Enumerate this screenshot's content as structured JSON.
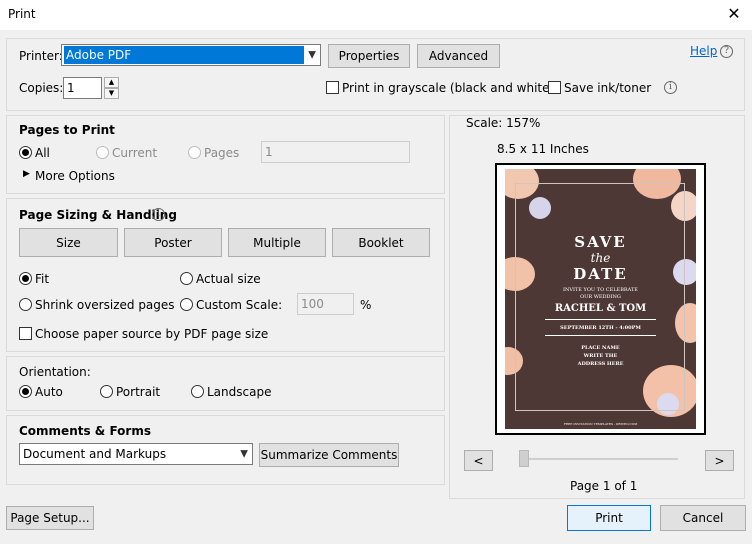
{
  "window": {
    "title": "Print",
    "close_glyph": "✕"
  },
  "printer": {
    "label": "Printer:",
    "selected": "Adobe PDF",
    "properties_label": "Properties",
    "advanced_label": "Advanced",
    "help_label": "Help"
  },
  "copies": {
    "label": "Copies:",
    "value": "1",
    "grayscale_label": "Print in grayscale (black and white)",
    "save_ink_label": "Save ink/toner"
  },
  "pages_to_print": {
    "header": "Pages to Print",
    "all_label": "All",
    "current_label": "Current",
    "pages_label": "Pages",
    "pages_value": "1",
    "more_options_label": "More Options"
  },
  "sizing": {
    "header": "Page Sizing & Handling",
    "size_label": "Size",
    "poster_label": "Poster",
    "multiple_label": "Multiple",
    "booklet_label": "Booklet",
    "fit_label": "Fit",
    "actual_size_label": "Actual size",
    "shrink_label": "Shrink oversized pages",
    "custom_scale_label": "Custom Scale:",
    "custom_scale_value": "100",
    "percent": "%",
    "paper_source_label": "Choose paper source by PDF page size"
  },
  "orientation": {
    "header": "Orientation:",
    "auto_label": "Auto",
    "portrait_label": "Portrait",
    "landscape_label": "Landscape"
  },
  "comments": {
    "header": "Comments & Forms",
    "selected": "Document and Markups",
    "summarize_label": "Summarize Comments"
  },
  "preview": {
    "scale": "Scale: 157%",
    "paper_size": "8.5 x 11 Inches",
    "prev_label": "<",
    "next_label": ">",
    "page_info": "Page 1 of 1",
    "card": {
      "save": "SAVE",
      "the": "the",
      "date": "DATE",
      "invite_line1": "INVITE YOU TO CELEBRATE",
      "invite_line2": "OUR WEDDING",
      "names": "RACHEL & TOM",
      "date_time": "SEPTEMBER 12TH - 4:00PM",
      "place1": "PLACE NAME",
      "place2": "WRITE THE",
      "place3": "ADDRESS HERE",
      "footer": "FREE INVITATION TEMPLATES - DRIVEO.COM"
    }
  },
  "footer": {
    "page_setup_label": "Page Setup...",
    "print_label": "Print",
    "cancel_label": "Cancel"
  },
  "colors": {
    "accent": "#0078d7",
    "selection": "#0078d7",
    "link": "#0066cc",
    "card_bg": "#4e3836"
  }
}
